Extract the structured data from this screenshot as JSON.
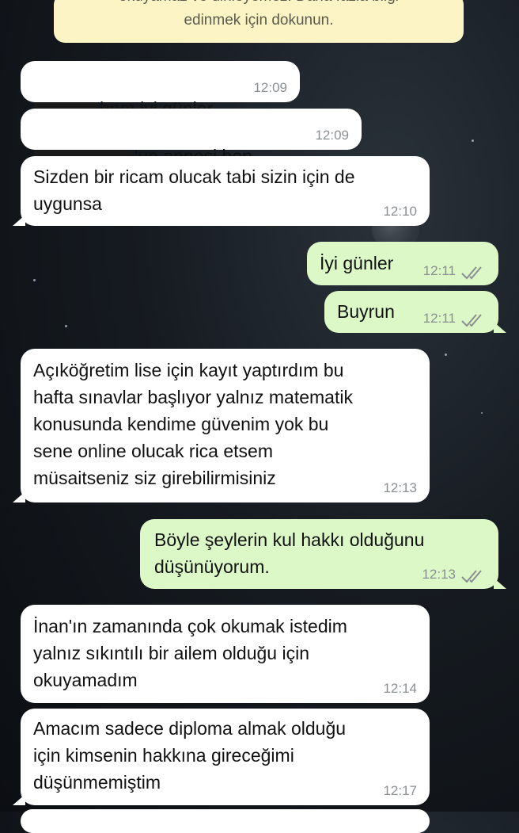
{
  "banner": {
    "line1": "okuyamaz ve dinleyemez. Daha fazla bilgi",
    "line2": "edinmek için dokunun."
  },
  "messages": [
    {
      "text": "hnm iyi günler",
      "time": "12:09"
    },
    {
      "text": "'un annesi ben",
      "time": "12:09"
    },
    {
      "text": "Sizden bir ricam olucak tabi sizin için de\nuygunsa",
      "time": "12:10"
    },
    {
      "text": "İyi günler",
      "time": "12:11"
    },
    {
      "text": "Buyrun",
      "time": "12:11"
    },
    {
      "text": "Açıköğretim lise için kayıt yaptırdım  bu\nhafta sınavlar başlıyor yalnız matematik\nkonusunda kendime güvenim yok bu\nsene online olucak  rica etsem\nmüsaitseniz siz girebilirmisiniz",
      "time": "12:13"
    },
    {
      "text": "Böyle şeylerin kul hakkı olduğunu\ndüşünüyorum.",
      "time": "12:13"
    },
    {
      "text": "İnan'ın  zamanında çok okumak istedim\nyalnız sıkıntılı  bir ailem olduğu için\nokuyamadım",
      "time": "12:14"
    },
    {
      "text": "Amacım sadece diploma almak olduğu\niçin kimsenin hakkına gireceğimi\ndüşünmemiştim",
      "time": "12:17"
    }
  ]
}
